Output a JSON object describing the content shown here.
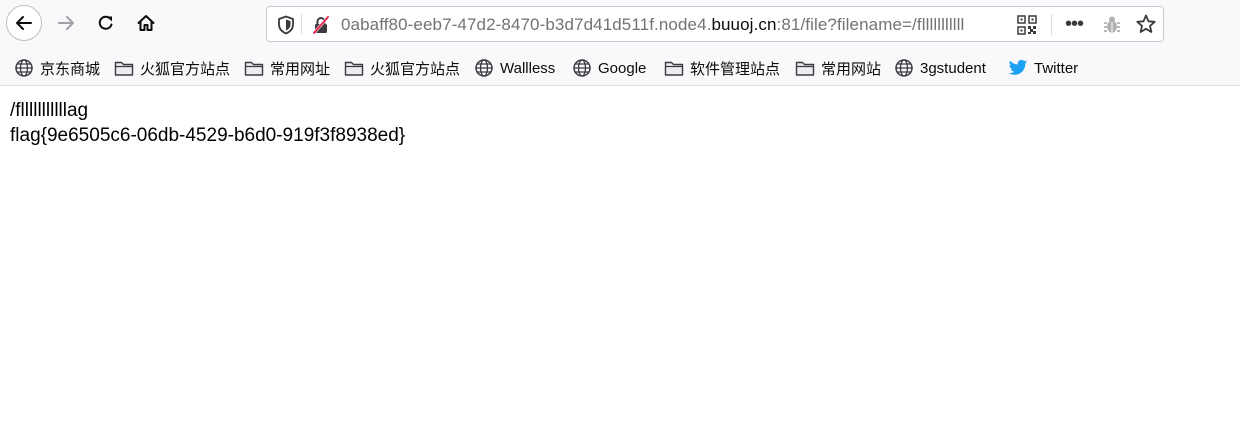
{
  "toolbar": {
    "back": "back-arrow",
    "forward": "forward-arrow",
    "reload": "reload",
    "home": "home"
  },
  "url": {
    "prefix": "0abaff80-eeb7-47d2-8470-b3d7d41d511f.node4.",
    "host": "buuoj.cn",
    "suffix": ":81/file?filename=/flllllllllll"
  },
  "bookmarks": [
    {
      "label": "京东商城",
      "icon": "globe"
    },
    {
      "label": "火狐官方站点",
      "icon": "folder"
    },
    {
      "label": "常用网址",
      "icon": "folder"
    },
    {
      "label": "火狐官方站点",
      "icon": "folder"
    },
    {
      "label": "Wallless",
      "icon": "globe"
    },
    {
      "label": "Google",
      "icon": "globe"
    },
    {
      "label": "软件管理站点",
      "icon": "folder"
    },
    {
      "label": "常用网站",
      "icon": "folder"
    },
    {
      "label": "3gstudent",
      "icon": "globe"
    },
    {
      "label": "Twitter",
      "icon": "twitter"
    }
  ],
  "content": {
    "line1": "/flllllllllllag",
    "line2": "flag{9e6505c6-06db-4529-b6d0-919f3f8938ed}"
  },
  "colors": {
    "toolbar_bg": "#f9f9fb",
    "twitter_blue": "#1da1f2"
  }
}
